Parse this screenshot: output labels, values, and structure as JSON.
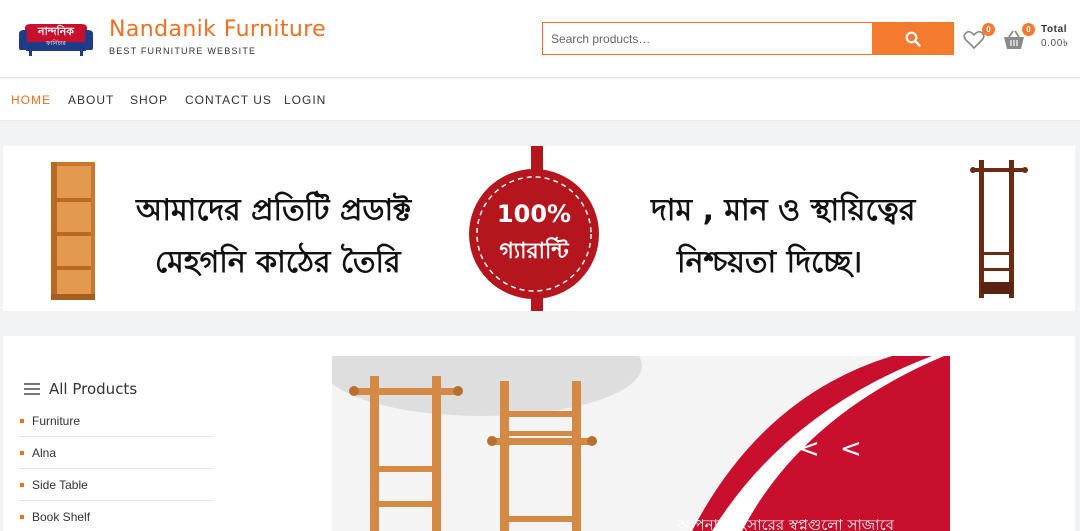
{
  "header": {
    "logo_line1": "নান্দনিক",
    "logo_line2": "ফার্নিচার",
    "site_name": "Nandanik Furniture",
    "tagline": "BEST FURNITURE WEBSITE"
  },
  "search": {
    "placeholder": "Search products…",
    "icon": "search-icon"
  },
  "wishlist": {
    "icon": "heart-icon",
    "count": "0"
  },
  "cart": {
    "icon": "basket-icon",
    "count": "0",
    "total_label": "Total",
    "total_value": "0.00৳"
  },
  "nav": {
    "items": [
      {
        "label": "HOME",
        "active": true
      },
      {
        "label": "ABOUT",
        "active": false
      },
      {
        "label": "SHOP",
        "active": false
      },
      {
        "label": "CONTACT US",
        "active": false
      },
      {
        "label": "LOGIN",
        "active": false
      }
    ]
  },
  "banner": {
    "left_line1": "আমাদের প্রতিটি প্রডাক্ট",
    "left_line2": "মেহগনি কাঠের তৈরি",
    "seal_line1": "100%",
    "seal_line2": "গ্যারান্টি",
    "right_line1": "দাম , মান ও স্থায়িত্বের",
    "right_line2": "নিশ্চয়তা দিচ্ছে।"
  },
  "categories": {
    "title": "All Products",
    "items": [
      "Furniture",
      "Alna",
      "Side Table",
      "Book Shelf"
    ]
  },
  "promo": {
    "chevrons": "< <",
    "caption": "আপনার সংসারের স্বপ্নগুলো সাজাবে"
  },
  "colors": {
    "accent": "#f26f21",
    "banner_red": "#b5161e",
    "promo_red": "#c8102e"
  }
}
